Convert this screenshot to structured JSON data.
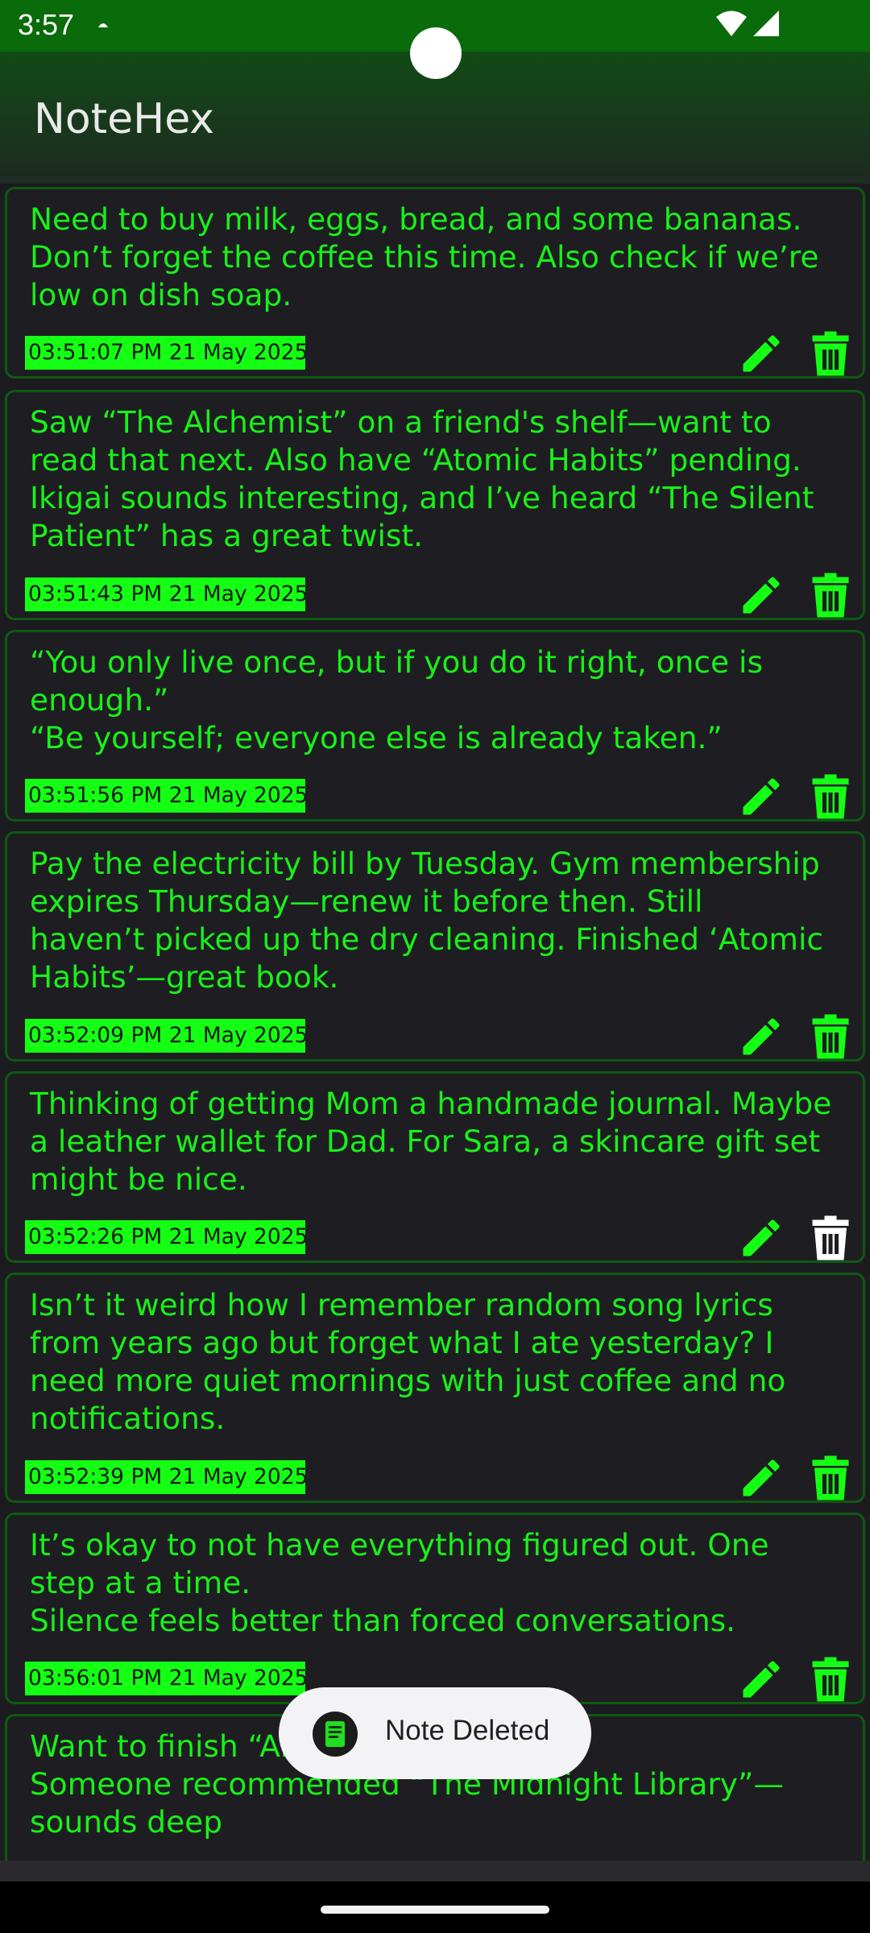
{
  "status_bar": {
    "time": "3:57"
  },
  "app": {
    "title": "NoteHex",
    "accent": "#14ff14",
    "text_color": "#19f019"
  },
  "notes": [
    {
      "text": "Need to buy milk, eggs, bread, and some bananas.\nDon’t forget the coffee this time. Also check if we’re\nlow on dish soap.",
      "timestamp": "03:51:07 PM 21 May 2025"
    },
    {
      "text": "Saw “The Alchemist” on a friend's shelf—want to\nread that next. Also have “Atomic Habits” pending.\nIkigai sounds interesting, and I’ve heard “The Silent\nPatient” has a great twist.",
      "timestamp": "03:51:43 PM 21 May 2025"
    },
    {
      "text": "“You only live once, but if you do it right, once is\nenough.”\n“Be yourself; everyone else is already taken.”",
      "timestamp": "03:51:56 PM 21 May 2025"
    },
    {
      "text": "Pay the electricity bill by Tuesday. Gym membership\nexpires Thursday—renew it before then. Still\nhaven’t picked up the dry cleaning. Finished ‘Atomic\nHabits’—great book.",
      "timestamp": "03:52:09 PM 21 May 2025"
    },
    {
      "text": "Thinking of getting Mom a handmade journal. Maybe\na leather wallet for Dad. For Sara, a skincare gift set\nmight be nice.",
      "timestamp": "03:52:26 PM 21 May 2025"
    },
    {
      "text": "Isn’t it weird how I remember random song lyrics\nfrom years ago but forget what I ate yesterday? I\nneed more quiet mornings with just coffee and no\nnotifications.",
      "timestamp": "03:52:39 PM 21 May 2025"
    },
    {
      "text": "It’s okay to not have everything figured out. One\nstep at a time.\nSilence feels better than forced conversations.",
      "timestamp": "03:56:01 PM 21 May 2025"
    },
    {
      "text": "Want to finish “A... me\nSomeone recommended “The Midnight Library”—\nsounds deep",
      "timestamp": ""
    }
  ],
  "toast": {
    "message": "Note Deleted"
  }
}
